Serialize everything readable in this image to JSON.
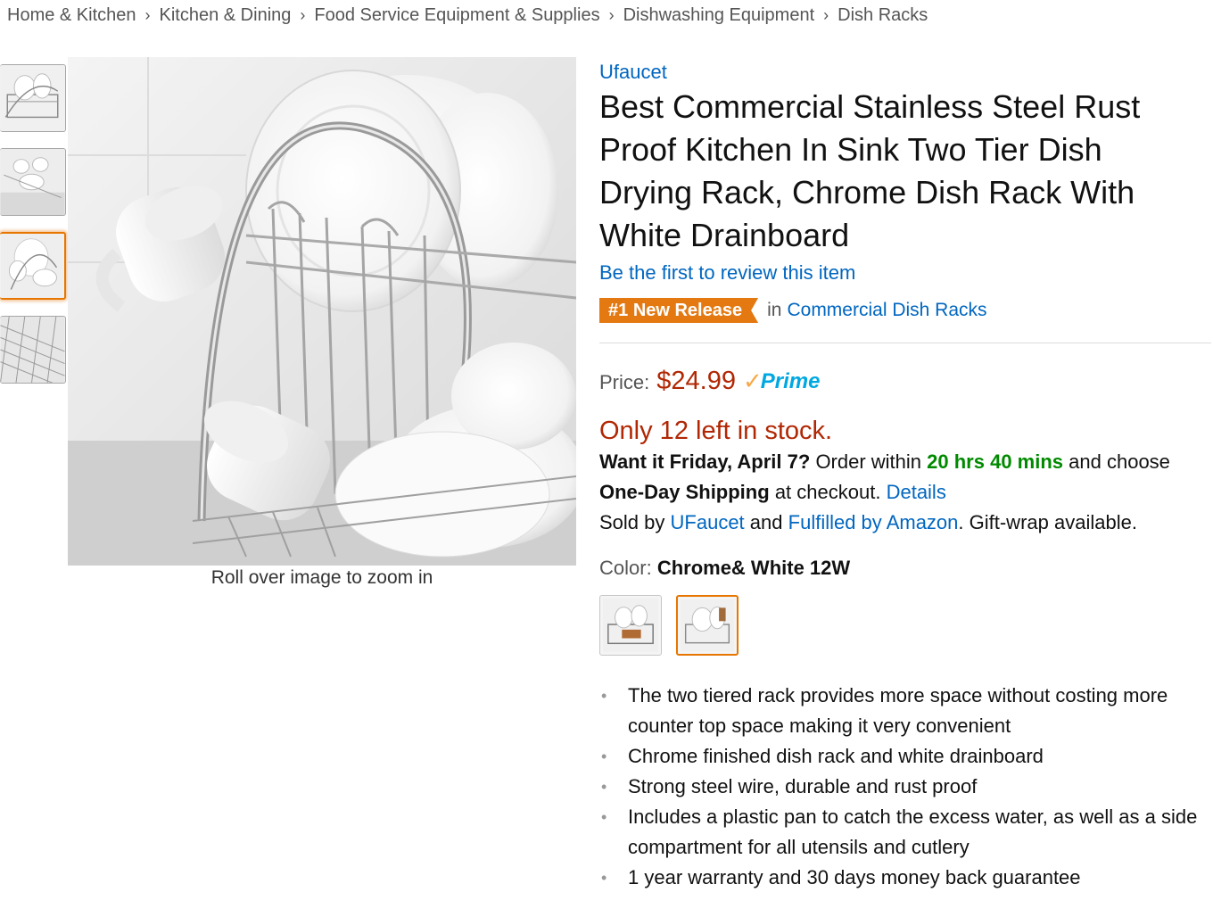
{
  "breadcrumb": [
    {
      "label": "Home & Kitchen"
    },
    {
      "label": "Kitchen & Dining"
    },
    {
      "label": "Food Service Equipment & Supplies"
    },
    {
      "label": "Dishwashing Equipment"
    },
    {
      "label": "Dish Racks"
    }
  ],
  "breadcrumb_separator": "›",
  "gallery": {
    "thumbnail_count": 4,
    "active_thumbnail": 3,
    "zoom_hint": "Roll over image to zoom in"
  },
  "product": {
    "brand": "Ufaucet",
    "title": "Best Commercial Stainless Steel Rust Proof Kitchen In Sink Two Tier Dish Drying Rack, Chrome Dish Rack With White Drainboard",
    "review_prompt": "Be the first to review this item",
    "badge": {
      "rank": "#1",
      "label": "New Release",
      "in_text": "in",
      "category": "Commercial Dish Racks",
      "color": "#e47911"
    }
  },
  "pricing": {
    "label": "Price:",
    "price": "$24.99",
    "prime_label": "Prime",
    "price_color": "#b12704",
    "prime_color": "#00a8e1"
  },
  "availability": {
    "stock": "Only 12 left in stock.",
    "want_it": "Want it Friday, April 7?",
    "order_within": "Order within",
    "countdown": "20 hrs 40 mins",
    "and_choose": "and choose",
    "shipping": "One-Day Shipping",
    "at_checkout": "at checkout.",
    "details_link": "Details",
    "sold_by": "Sold by",
    "seller": "UFaucet",
    "and": "and",
    "fulfilled": "Fulfilled by Amazon",
    "gift_wrap": ". Gift-wrap available."
  },
  "color_selector": {
    "label": "Color:",
    "value": "Chrome& White 12W",
    "selected_index": 1,
    "swatch_count": 2
  },
  "features": [
    "The two tiered rack provides more space without costing more counter top space making it very convenient",
    "Chrome finished dish rack and white drainboard",
    "Strong steel wire, durable and rust proof",
    "Includes a plastic pan to catch the excess water, as well as a side compartment for all utensils and cutlery",
    "1 year warranty and 30 days money back guarantee"
  ],
  "colors": {
    "link": "#0066c0",
    "accent": "#e77600",
    "success": "#008a00"
  }
}
